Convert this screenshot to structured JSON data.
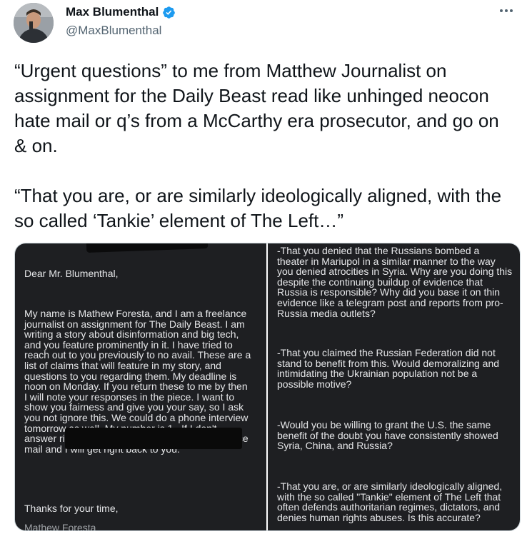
{
  "author": {
    "name": "Max Blumenthal",
    "handle": "@MaxBlumenthal"
  },
  "tweet": {
    "paragraphs": [
      "“Urgent questions” to me from Matthew Journalist on assignment for the Daily Beast read like unhinged neocon hate mail or q’s from a McCarthy era prosecutor, and go on & on.",
      "“That you are, or are similarly ideologically aligned, with the so called ‘Tankie’ element of The Left…”"
    ]
  },
  "media": {
    "left": {
      "greeting": "Dear Mr. Blumenthal,",
      "body": "My name is Mathew Foresta, and I am a freelance journalist on assignment for The Daily Beast. I am writing a story about disinformation and big tech, and you feature prominently in it. I have tried to reach out to you previously to no avail. These are a list of claims that will feature in my story, and questions to you regarding them. My deadline is noon on Monday. If you return these to me by then I will note your responses in the piece. I want to show you fairness and give you your say, so I ask you not ignore this. We could do a phone interview tomorrow as well. My number is 1 . If I don't answer right away please text and/or leave a voice mail and I will get right back to you.",
      "thanks": "Thanks for your time,",
      "signature": "Mathew Foresta"
    },
    "right": {
      "questions": [
        "-That you denied that the Russians bombed a theater in Mariupol in a similar manner to the way you denied atrocities in Syria. Why are you doing this despite the continuing buildup of evidence that Russia is responsible? Why did you base it on thin evidence like a telegram post and reports from pro-Russia media outlets?",
        "-That you claimed the Russian Federation did not stand to benefit from this. Would demoralizing and intimidating the Ukrainian population not be a possible motive?",
        "-Would you be willing to grant the U.S. the same benefit of the doubt you have consistently showed Syria, China, and Russia?",
        "-That you are, or are similarly ideologically aligned, with the so called \"Tankie\" element of The Left that often defends authoritarian regimes, dictators, and denies human rights abuses. Is this accurate?"
      ]
    }
  },
  "colors": {
    "text": "#0f1419",
    "secondary": "#536471",
    "verified": "#1d9bf0",
    "panel_bg": "#1e1f22",
    "panel_text": "#e6e7e9"
  },
  "icons": {
    "verified": "verified-badge-icon",
    "more": "more-options-icon"
  }
}
